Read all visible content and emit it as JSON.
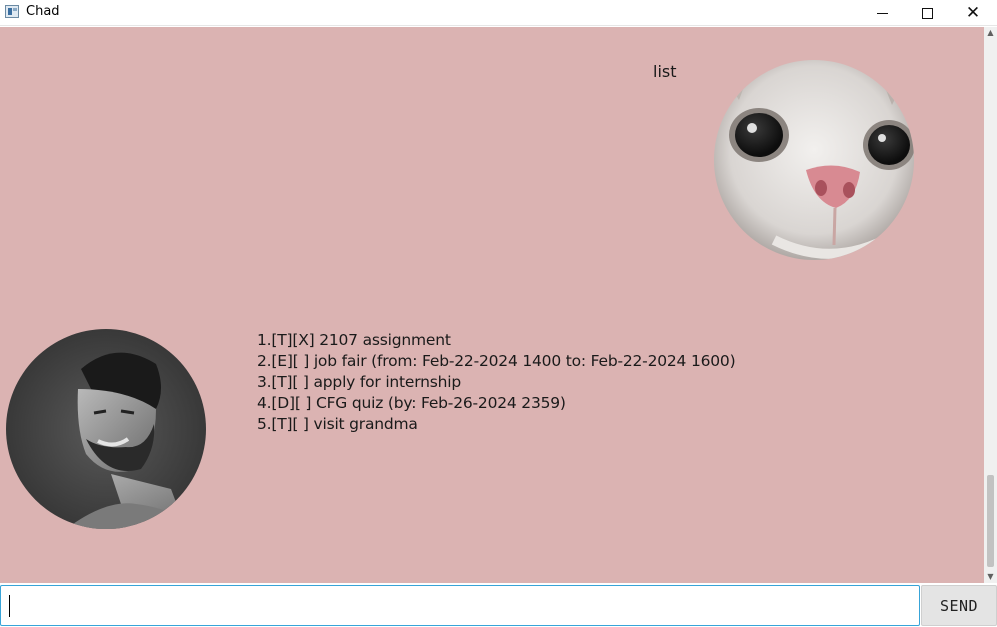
{
  "window": {
    "title": "Chad",
    "icon": "app-window-icon",
    "controls": [
      "minimize-icon",
      "maximize-icon",
      "close-icon"
    ]
  },
  "chat": {
    "background": "#dbb3b2",
    "user_message": "list",
    "user_avatar": "cat-face-avatar",
    "bot_avatar": "chad-face-avatar",
    "bot_response_lines": [
      "1.[T][X] 2107 assignment",
      "2.[E][ ] job fair (from: Feb-22-2024 1400 to: Feb-22-2024 1600)",
      "3.[T][ ] apply for internship",
      "4.[D][ ] CFG quiz (by: Feb-26-2024 2359)",
      "5.[T][ ] visit grandma"
    ]
  },
  "input": {
    "value": "",
    "accent": "#38a4d8"
  },
  "send_button": {
    "label": "SEND"
  }
}
